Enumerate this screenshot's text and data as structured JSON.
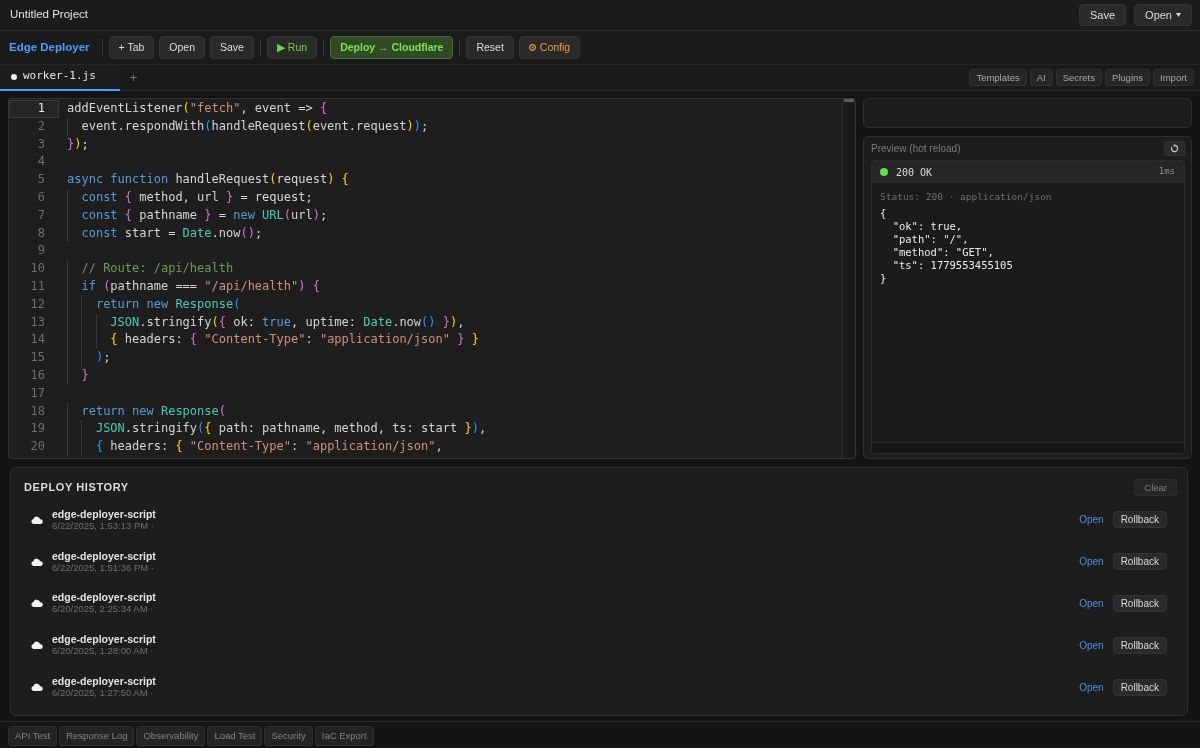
{
  "window": {
    "title": "Untitled Project",
    "buttons": [
      {
        "label": "Save",
        "kind": "plain"
      },
      {
        "label": "Open",
        "kind": "dropdown"
      }
    ]
  },
  "toolbar": {
    "brand": "Edge Deployer",
    "groups": [
      [
        {
          "label": "+ Tab",
          "kind": "plain"
        },
        {
          "label": "Open",
          "kind": "plain"
        },
        {
          "label": "Save",
          "kind": "plain"
        }
      ],
      [
        {
          "label": "▶ Run",
          "kind": "run"
        }
      ],
      [
        {
          "label": "Deploy → Cloudflare",
          "kind": "deploy"
        }
      ],
      [
        {
          "label": "Reset",
          "kind": "plain"
        },
        {
          "label": "Config",
          "kind": "config"
        }
      ]
    ]
  },
  "file_tabs": [
    {
      "label": "worker-1.js",
      "selected": true,
      "modified": true
    }
  ],
  "add_tab": "+",
  "tools": [
    "Templates",
    "AI",
    "Secrets",
    "Plugins",
    "Import"
  ],
  "editor": {
    "lines": [
      {
        "number": "1",
        "active": true,
        "tokens": [
          {
            "kind": "text",
            "text": "addEventListener"
          },
          {
            "kind": "bracket1",
            "text": "("
          },
          {
            "kind": "string",
            "text": "\"fetch\""
          },
          {
            "kind": "text",
            "text": ", event => "
          },
          {
            "kind": "bracket2",
            "text": "{"
          }
        ]
      },
      {
        "number": "2",
        "active": false,
        "tokens": [
          {
            "kind": "text",
            "text": "  event.respondWith"
          },
          {
            "kind": "bracket3",
            "text": "("
          },
          {
            "kind": "text",
            "text": "handleRequest"
          },
          {
            "kind": "bracket1",
            "text": "("
          },
          {
            "kind": "text",
            "text": "event.request"
          },
          {
            "kind": "bracket1",
            "text": ")"
          },
          {
            "kind": "bracket3",
            "text": ")"
          },
          {
            "kind": "text",
            "text": ";"
          }
        ]
      },
      {
        "number": "3",
        "active": false,
        "tokens": [
          {
            "kind": "bracket2",
            "text": "}"
          },
          {
            "kind": "bracket1",
            "text": ")"
          },
          {
            "kind": "text",
            "text": ";"
          }
        ]
      },
      {
        "number": "4",
        "active": false
      },
      {
        "number": "5",
        "active": false,
        "tokens": [
          {
            "kind": "keyword",
            "text": "async function"
          },
          {
            "kind": "text",
            "text": " handleRequest"
          },
          {
            "kind": "bracket1",
            "text": "("
          },
          {
            "kind": "text",
            "text": "request"
          },
          {
            "kind": "bracket1",
            "text": ") {"
          }
        ]
      },
      {
        "number": "6",
        "active": false,
        "tokens": [
          {
            "kind": "keyword",
            "text": "  const"
          },
          {
            "kind": "bracket2",
            "text": " {"
          },
          {
            "kind": "text",
            "text": " method, url "
          },
          {
            "kind": "bracket2",
            "text": "}"
          },
          {
            "kind": "text",
            "text": " = request;"
          }
        ]
      },
      {
        "number": "7",
        "active": false,
        "tokens": [
          {
            "kind": "keyword",
            "text": "  const"
          },
          {
            "kind": "bracket2",
            "text": " {"
          },
          {
            "kind": "text",
            "text": " pathname "
          },
          {
            "kind": "bracket2",
            "text": "}"
          },
          {
            "kind": "text",
            "text": " = "
          },
          {
            "kind": "keyword",
            "text": "new"
          },
          {
            "kind": "type",
            "text": " URL"
          },
          {
            "kind": "bracket2",
            "text": "("
          },
          {
            "kind": "text",
            "text": "url"
          },
          {
            "kind": "bracket2",
            "text": ")"
          },
          {
            "kind": "text",
            "text": ";"
          }
        ]
      },
      {
        "number": "8",
        "active": false,
        "tokens": [
          {
            "kind": "keyword",
            "text": "  const"
          },
          {
            "kind": "text",
            "text": " start = "
          },
          {
            "kind": "type",
            "text": "Date"
          },
          {
            "kind": "text",
            "text": ".now"
          },
          {
            "kind": "bracket2",
            "text": "()"
          },
          {
            "kind": "text",
            "text": ";"
          }
        ]
      },
      {
        "number": "9",
        "active": false
      },
      {
        "number": "10",
        "active": false,
        "tokens": [
          {
            "kind": "comment",
            "text": "  // Route: /api/health"
          }
        ]
      },
      {
        "number": "11",
        "active": false,
        "tokens": [
          {
            "kind": "keyword",
            "text": "  if"
          },
          {
            "kind": "bracket2",
            "text": " ("
          },
          {
            "kind": "text",
            "text": "pathname === "
          },
          {
            "kind": "string",
            "text": "\"/api/health\""
          },
          {
            "kind": "bracket2",
            "text": ") {"
          }
        ]
      },
      {
        "number": "12",
        "active": false,
        "tokens": [
          {
            "kind": "keyword",
            "text": "    return new"
          },
          {
            "kind": "type",
            "text": " Response"
          },
          {
            "kind": "bracket3",
            "text": "("
          }
        ]
      },
      {
        "number": "13",
        "active": false,
        "tokens": [
          {
            "kind": "type",
            "text": "      JSON"
          },
          {
            "kind": "text",
            "text": ".stringify"
          },
          {
            "kind": "bracket1",
            "text": "("
          },
          {
            "kind": "bracket2",
            "text": "{"
          },
          {
            "kind": "text",
            "text": " ok: "
          },
          {
            "kind": "keyword",
            "text": "true"
          },
          {
            "kind": "text",
            "text": ", uptime: "
          },
          {
            "kind": "type",
            "text": "Date"
          },
          {
            "kind": "text",
            "text": ".now"
          },
          {
            "kind": "bracket3",
            "text": "()"
          },
          {
            "kind": "bracket2",
            "text": " }"
          },
          {
            "kind": "bracket1",
            "text": ")"
          },
          {
            "kind": "text",
            "text": ","
          }
        ]
      },
      {
        "number": "14",
        "active": false,
        "tokens": [
          {
            "kind": "bracket1",
            "text": "      {"
          },
          {
            "kind": "text",
            "text": " headers: "
          },
          {
            "kind": "bracket2",
            "text": "{"
          },
          {
            "kind": "string",
            "text": " \"Content-Type\""
          },
          {
            "kind": "text",
            "text": ": "
          },
          {
            "kind": "string",
            "text": "\"application/json\""
          },
          {
            "kind": "bracket2",
            "text": " }"
          },
          {
            "kind": "bracket1",
            "text": " }"
          }
        ]
      },
      {
        "number": "15",
        "active": false,
        "tokens": [
          {
            "kind": "bracket3",
            "text": "    )"
          },
          {
            "kind": "text",
            "text": ";"
          }
        ]
      },
      {
        "number": "16",
        "active": false,
        "tokens": [
          {
            "kind": "bracket2",
            "text": "  }"
          }
        ]
      },
      {
        "number": "17",
        "active": false
      },
      {
        "number": "18",
        "active": false,
        "tokens": [
          {
            "kind": "keyword",
            "text": "  return new"
          },
          {
            "kind": "type",
            "text": " Response"
          },
          {
            "kind": "bracket2",
            "text": "("
          }
        ]
      },
      {
        "number": "19",
        "active": false,
        "tokens": [
          {
            "kind": "type",
            "text": "    JSON"
          },
          {
            "kind": "text",
            "text": ".stringify"
          },
          {
            "kind": "bracket3",
            "text": "("
          },
          {
            "kind": "bracket1",
            "text": "{"
          },
          {
            "kind": "text",
            "text": " path: pathname, method, ts: start "
          },
          {
            "kind": "bracket1",
            "text": "}"
          },
          {
            "kind": "bracket3",
            "text": ")"
          },
          {
            "kind": "text",
            "text": ","
          }
        ]
      },
      {
        "number": "20",
        "active": false,
        "tokens": [
          {
            "kind": "bracket3",
            "text": "    {"
          },
          {
            "kind": "text",
            "text": " headers: "
          },
          {
            "kind": "bracket1",
            "text": "{"
          },
          {
            "kind": "string",
            "text": " \"Content-Type\""
          },
          {
            "kind": "text",
            "text": ": "
          },
          {
            "kind": "string",
            "text": "\"application/json\""
          },
          {
            "kind": "text",
            "text": ","
          }
        ]
      }
    ]
  },
  "preview": {
    "title": "Preview (hot reload)",
    "response": {
      "ok": true,
      "status": "200 OK",
      "time": "1ms",
      "meta": "Status: 200 · application/json",
      "body": "{\n  \"ok\": true,\n  \"path\": \"/\",\n  \"method\": \"GET\",\n  \"ts\": 1779553455105\n}"
    }
  },
  "deploy_history": {
    "title": "DEPLOY HISTORY",
    "clear": {
      "label": "Clear",
      "disabled": true
    },
    "entries": [
      {
        "name": "edge-deployer-script",
        "time": "6/22/2025, 1:53:13 PM ·",
        "open": "Open",
        "rollback": "Rollback"
      },
      {
        "name": "edge-deployer-script",
        "time": "6/22/2025, 1:51:36 PM ·",
        "open": "Open",
        "rollback": "Rollback"
      },
      {
        "name": "edge-deployer-script",
        "time": "6/20/2025, 2:25:34 AM ·",
        "open": "Open",
        "rollback": "Rollback"
      },
      {
        "name": "edge-deployer-script",
        "time": "6/20/2025, 1:28:00 AM ·",
        "open": "Open",
        "rollback": "Rollback"
      },
      {
        "name": "edge-deployer-script",
        "time": "6/20/2025, 1:27:50 AM ·",
        "open": "Open",
        "rollback": "Rollback"
      }
    ]
  },
  "bottom_tabs": [
    "API Test",
    "Response Log",
    "Observability",
    "Load Test",
    "Security",
    "IaC Export"
  ]
}
